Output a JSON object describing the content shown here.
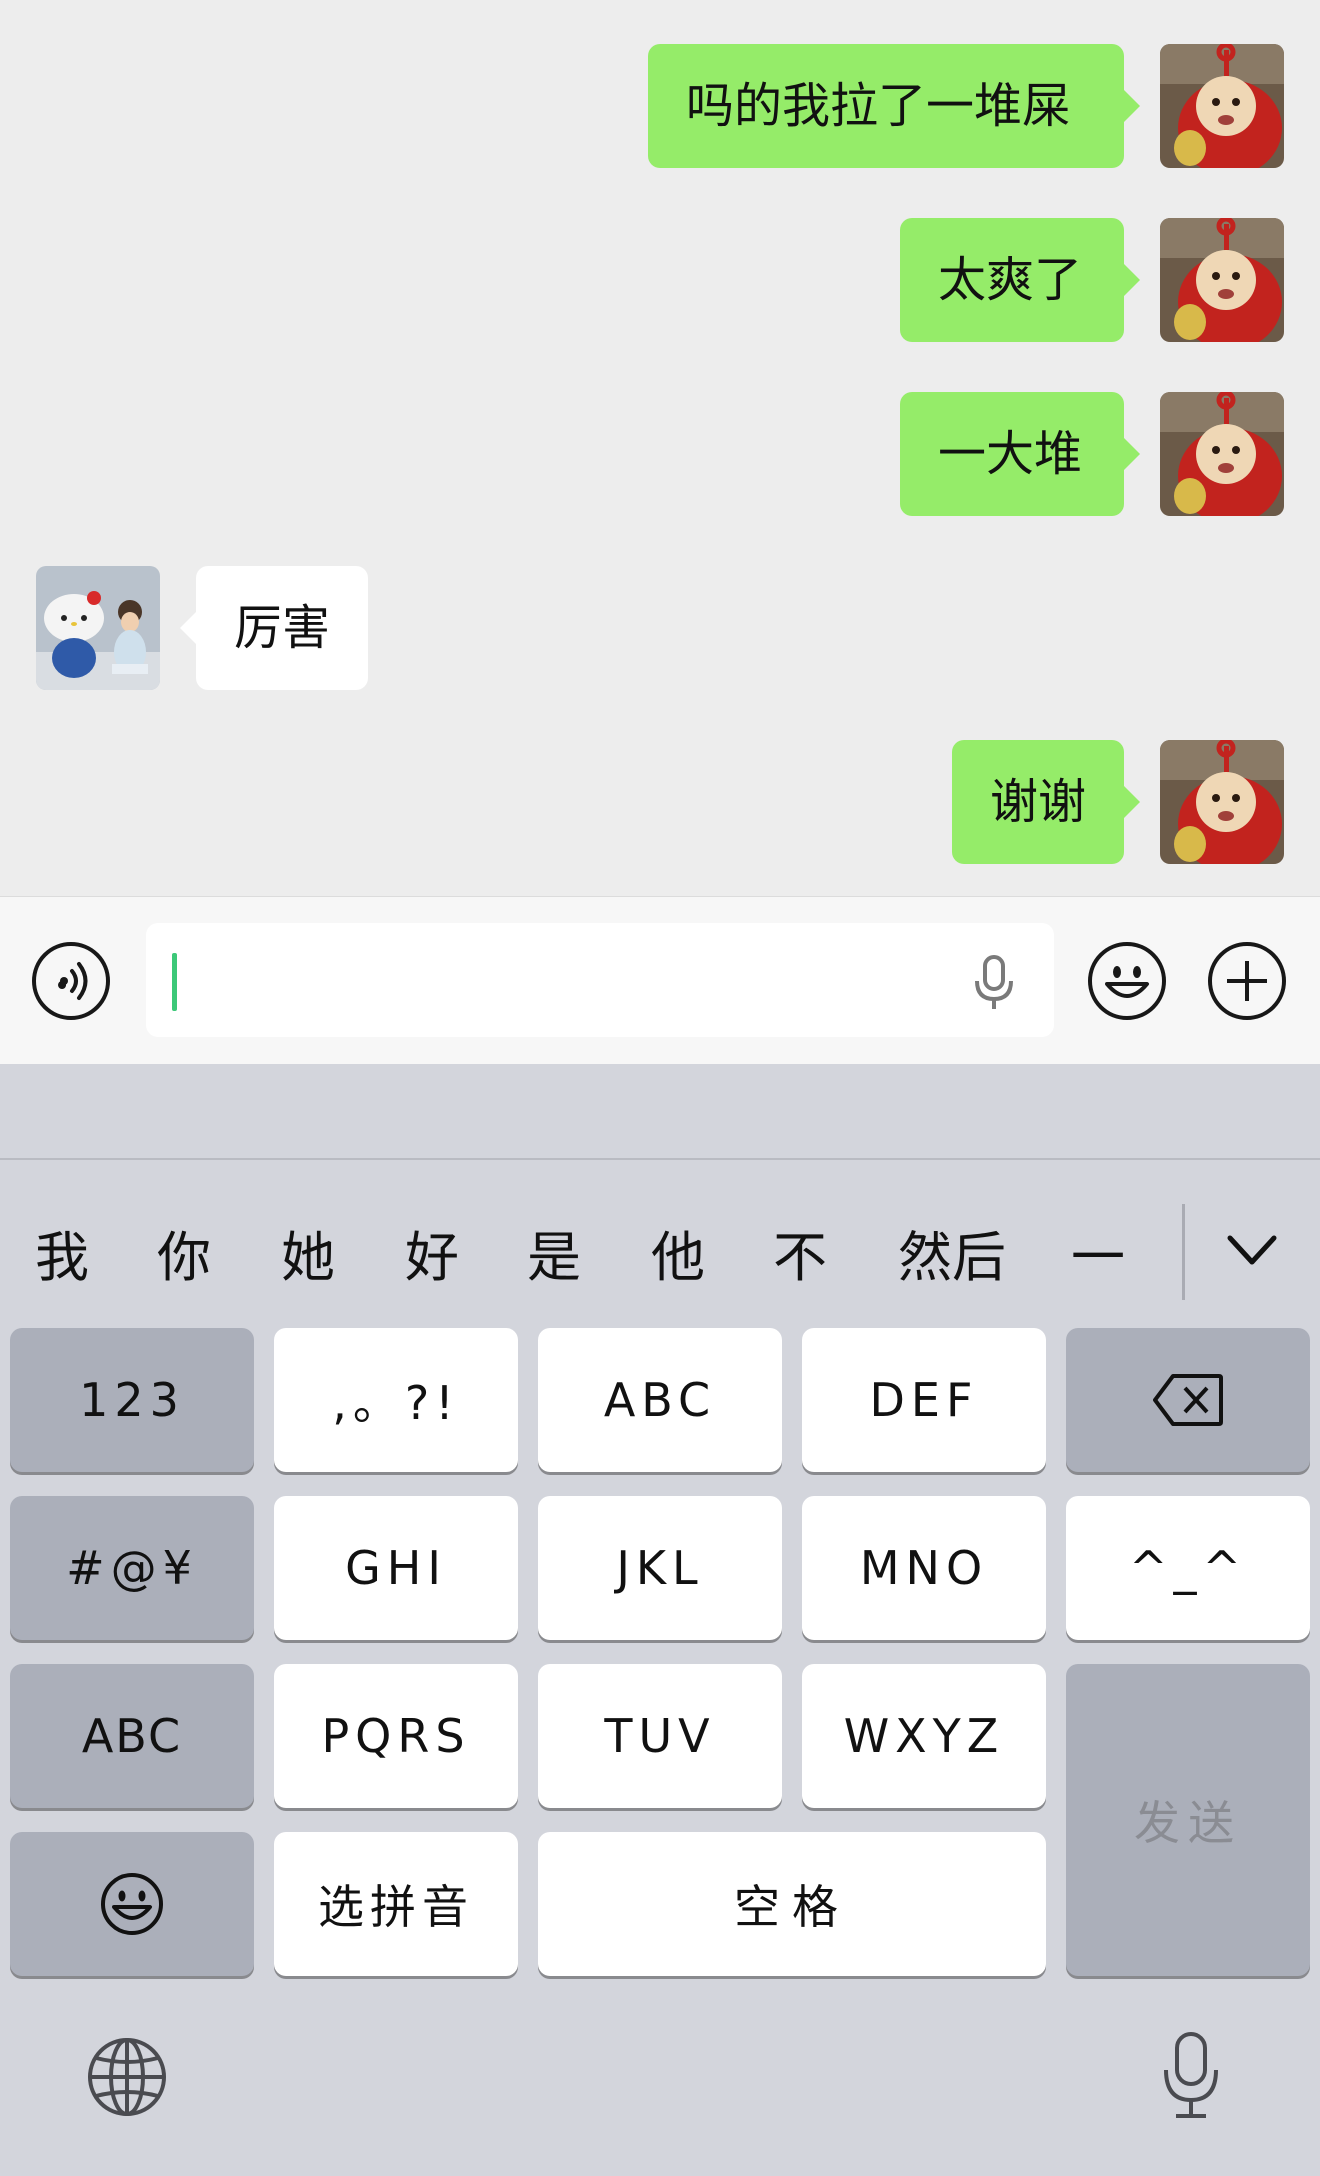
{
  "messages": [
    {
      "side": "out",
      "text": "吗的我拉了一堆屎",
      "avatar": "red-teletubby-avatar"
    },
    {
      "side": "out",
      "text": "太爽了",
      "avatar": "red-teletubby-avatar"
    },
    {
      "side": "out",
      "text": "一大堆",
      "avatar": "red-teletubby-avatar"
    },
    {
      "side": "in",
      "text": "厉害",
      "avatar": "girl-with-hello-kitty-avatar"
    },
    {
      "side": "out",
      "text": "谢谢",
      "avatar": "red-teletubby-avatar"
    }
  ],
  "input_bar": {
    "voice_icon": "voice-icon",
    "text_value": "",
    "mic_icon": "microphone-icon",
    "emoji_icon": "emoji-icon",
    "plus_icon": "plus-icon"
  },
  "candidates": [
    "我",
    "你",
    "她",
    "好",
    "是",
    "他",
    "不",
    "然后",
    "一"
  ],
  "keys": {
    "num": "123",
    "punct": ",。?!",
    "abc2": "ABC",
    "def": "DEF",
    "backspace_icon": "backspace-icon",
    "symbols": "#@¥",
    "ghi": "GHI",
    "jkl": "JKL",
    "mno": "MNO",
    "kaomoji": "^_^",
    "abc_switch": "ABC",
    "pqrs": "PQRS",
    "tuv": "TUV",
    "wxyz": "WXYZ",
    "send": "发送",
    "emoji_key_icon": "smiley-icon",
    "select_pinyin": "选拼音",
    "space": "空格"
  },
  "bottom": {
    "globe_icon": "globe-icon",
    "dictation_icon": "microphone-icon"
  },
  "colors": {
    "outgoing_bubble": "#95ec69",
    "incoming_bubble": "#ffffff",
    "chat_background": "#ededed",
    "caret": "#3cc878"
  }
}
